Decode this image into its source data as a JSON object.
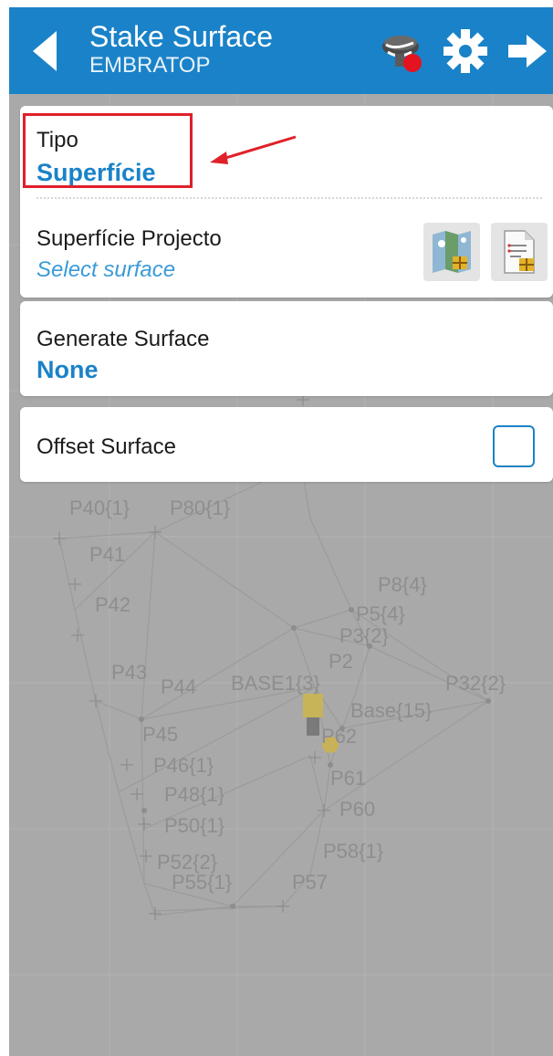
{
  "header": {
    "title": "Stake Surface",
    "subtitle": "EMBRATOP",
    "icons": [
      "back-arrow-icon",
      "gnss-receiver-icon",
      "settings-gear-icon",
      "next-arrow-icon"
    ]
  },
  "tipo": {
    "label": "Tipo",
    "value": "Superfície"
  },
  "project_surface": {
    "label": "Superfície Projecto",
    "placeholder": "Select surface",
    "icons": [
      "map-surface-icon",
      "surface-file-icon"
    ]
  },
  "generate_surface": {
    "label": "Generate Surface",
    "value": "None"
  },
  "offset_surface": {
    "label": "Offset Surface",
    "checked": false
  },
  "map": {
    "points": [
      "P40{1}",
      "P80{1}",
      "P41",
      "P42",
      "P43",
      "P44",
      "BASE1{3}",
      "P45",
      "P46{1}",
      "P48{1}",
      "P50{1}",
      "P52{2}",
      "P55{1}",
      "P57",
      "P8{4}",
      "P5{4}",
      "P3{2}",
      "P2",
      "P32{2}",
      "Base{15}",
      "P62",
      "P61",
      "P60",
      "P58{1}"
    ]
  },
  "colors": {
    "accent": "#1a82c8",
    "highlight": "#e0202a",
    "map_background": "#a9a9a9"
  }
}
